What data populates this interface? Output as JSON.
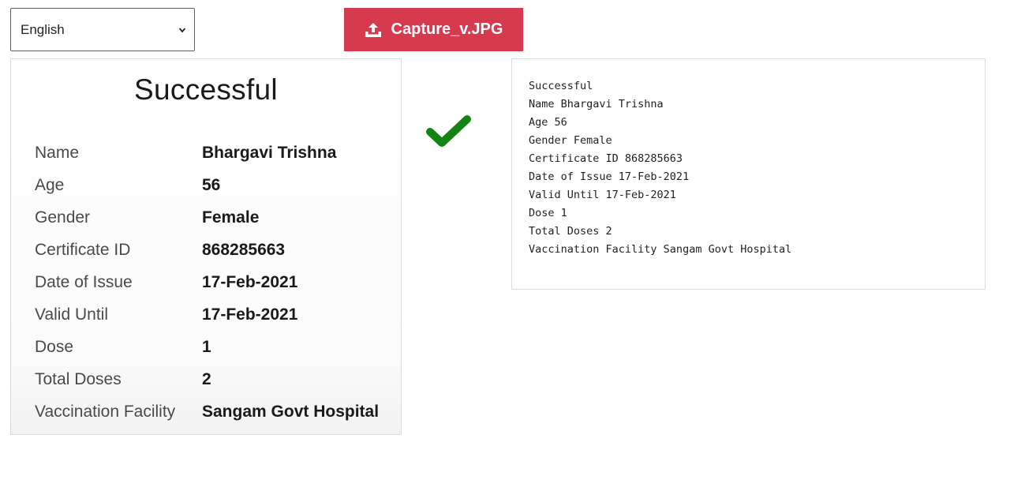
{
  "language_select": {
    "selected": "English"
  },
  "upload_button": {
    "label": "Capture_v.JPG",
    "icon": "upload-icon",
    "color": "#d63a4f"
  },
  "certificate_image": {
    "title": "Successful",
    "rows": [
      {
        "label": "Name",
        "value": "Bhargavi Trishna"
      },
      {
        "label": "Age",
        "value": "56"
      },
      {
        "label": "Gender",
        "value": "Female"
      },
      {
        "label": "Certificate ID",
        "value": "868285663"
      },
      {
        "label": "Date of Issue",
        "value": "17-Feb-2021"
      },
      {
        "label": "Valid Until",
        "value": "17-Feb-2021"
      },
      {
        "label": "Dose",
        "value": "1"
      },
      {
        "label": "Total Doses",
        "value": "2"
      },
      {
        "label": "Vaccination Facility",
        "value": "Sangam Govt Hospital"
      }
    ]
  },
  "status": {
    "icon": "checkmark-icon",
    "color": "#138313"
  },
  "extracted_text": {
    "lines": [
      "Successful",
      "Name Bhargavi Trishna",
      "Age 56",
      "Gender Female",
      "Certificate ID 868285663",
      "Date of Issue 17-Feb-2021",
      "Valid Until 17-Feb-2021",
      "Dose 1",
      "Total Doses 2",
      "Vaccination Facility Sangam Govt Hospital"
    ]
  }
}
